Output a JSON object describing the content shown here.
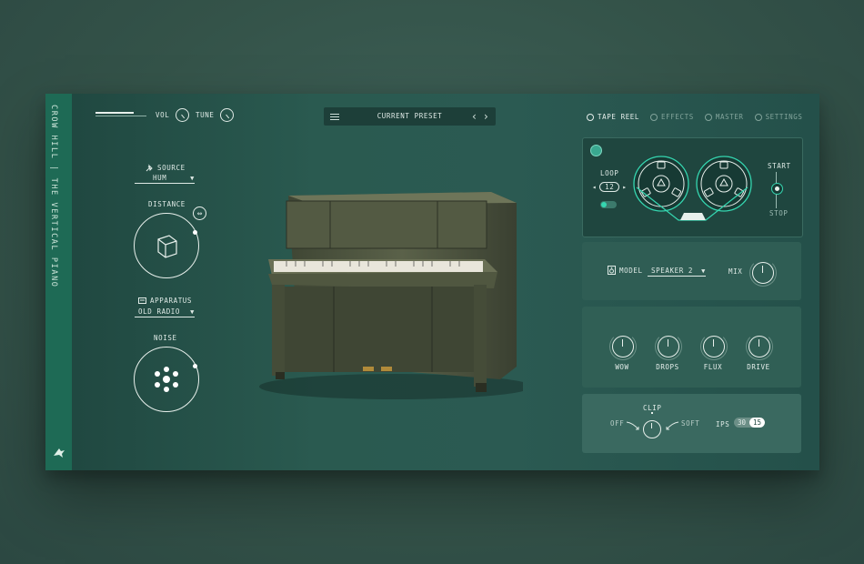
{
  "brand": {
    "vertical_text": "CROW HILL | THE VERTICAL PIANO",
    "logo": "crow-logo-icon"
  },
  "topbar": {
    "vol_label": "VOL",
    "tune_label": "TUNE",
    "vol_level": 0.75,
    "preset": {
      "name": "CURRENT PRESET",
      "prev": "‹",
      "next": "›"
    },
    "tabs": [
      {
        "label": "TAPE REEL",
        "active": true
      },
      {
        "label": "EFFECTS",
        "active": false
      },
      {
        "label": "MASTER",
        "active": false
      },
      {
        "label": "SETTINGS",
        "active": false
      }
    ]
  },
  "left": {
    "source": {
      "label": "SOURCE",
      "value": "HUM",
      "icon": "plug-icon"
    },
    "distance": {
      "label": "DISTANCE",
      "icon": "cube-icon",
      "link_icon": "link-icon"
    },
    "apparatus": {
      "label": "APPARATUS",
      "value": "OLD RADIO",
      "icon": "radio-icon"
    },
    "noise": {
      "label": "NOISE",
      "icon": "dots-icon"
    }
  },
  "tape": {
    "loop_label": "LOOP",
    "loop_value": "12",
    "start_label": "START",
    "stop_label": "STOP"
  },
  "model": {
    "label": "MODEL",
    "value": "SPEAKER 2",
    "mix_label": "MIX",
    "icon": "speaker-icon"
  },
  "knobs": [
    {
      "label": "WOW"
    },
    {
      "label": "DROPS"
    },
    {
      "label": "FLUX"
    },
    {
      "label": "DRIVE"
    }
  ],
  "clip": {
    "label": "CLIP",
    "off": "OFF",
    "soft": "SOFT",
    "ips_label": "IPS",
    "ips_options": [
      "30",
      "15"
    ],
    "ips_selected": "15"
  },
  "colors": {
    "accent": "#35d6b0",
    "panel": "#2b5a52",
    "sidebar": "#1e6a55"
  }
}
